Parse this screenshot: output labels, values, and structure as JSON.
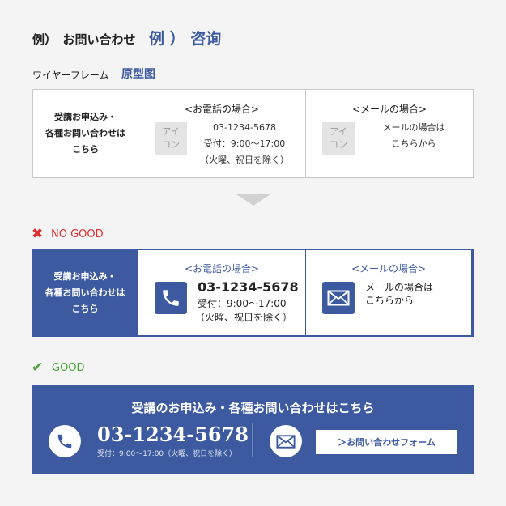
{
  "header": {
    "title_jp": "例）　お問い合わせ",
    "title_cn": "例 ）  咨询",
    "wireframe_jp": "ワイヤーフレーム",
    "wireframe_cn": "原型图"
  },
  "wireframe": {
    "left_lines": [
      "受講お申込み・",
      "各種お問い合わせは",
      "こちら"
    ],
    "phone": {
      "heading": "<お電話の場合>",
      "icon_placeholder": [
        "アイ",
        "コン"
      ],
      "lines": [
        "03-1234-5678",
        "受付：9:00〜17:00",
        "（火曜、祝日を除く）"
      ]
    },
    "mail": {
      "heading": "<メールの場合>",
      "icon_placeholder": [
        "アイ",
        "コン"
      ],
      "lines": [
        "メールの場合は",
        "こちらから"
      ]
    }
  },
  "no_good": {
    "mark": "✖",
    "label": "NO GOOD",
    "left_lines": [
      "受講お申込み・",
      "各種お問い合わせは",
      "こちら"
    ],
    "phone": {
      "heading": "<お電話の場合>",
      "number": "03-1234-5678",
      "hours": "受付：9:00〜17:00",
      "note": "（火曜、祝日を除く）"
    },
    "mail": {
      "heading": "<メールの場合>",
      "lines": [
        "メールの場合は",
        "こちらから"
      ]
    }
  },
  "good": {
    "mark": "✔",
    "label": "GOOD",
    "heading": "受講のお申込み・各種お問い合わせはこちら",
    "phone_number": "03-1234-5678",
    "hours": "受付：9:00〜17:00（火曜、祝日を除く）",
    "form_button": "＞お問い合わせフォーム"
  },
  "colors": {
    "brand_blue": "#3d5aa0",
    "ng_red": "#e02d2d",
    "good_green": "#4ca23a",
    "placeholder_gray": "#e4e4e4"
  },
  "icons": {
    "phone": "phone-icon",
    "mail": "mail-icon",
    "arrow": "down-arrow-icon"
  }
}
